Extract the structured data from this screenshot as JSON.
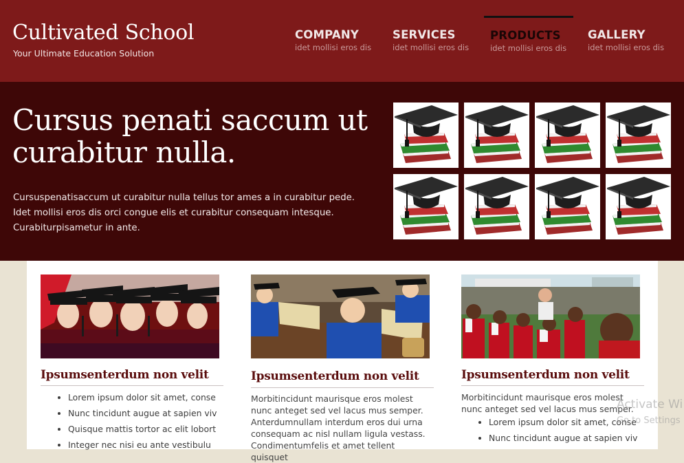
{
  "header": {
    "title": "Cultivated School",
    "subtitle": "Your Ultimate Education Solution",
    "nav": [
      {
        "label": "COMPANY",
        "sub": "idet mollisi eros dis",
        "active": false
      },
      {
        "label": "SERVICES",
        "sub": "idet mollisi eros dis",
        "active": false
      },
      {
        "label": "PRODUCTS",
        "sub": "idet mollisi eros dis",
        "active": true
      },
      {
        "label": "GALLERY",
        "sub": "idet mollisi eros dis",
        "active": false
      }
    ]
  },
  "hero": {
    "title": "Cursus penati saccum ut curabitur nulla.",
    "text": "Cursuspenatisaccum ut curabitur nulla tellus tor ames a in curabitur pede. Idet mollisi eros dis orci congue elis et curabitur consequam intesque. Curabiturpisametur in ante.",
    "thumbnail_icon": "graduation-cap-books-icon"
  },
  "columns": [
    {
      "title": "Ipsumsenterdum non velit",
      "photo": "graduates-photo",
      "items": [
        "Lorem ipsum dolor sit amet, conse",
        "Nunc tincidunt augue at sapien viv",
        "Quisque mattis tortor ac elit lobort",
        "Integer nec nisi eu ante vestibulu"
      ]
    },
    {
      "title": "Ipsumsenterdum non velit",
      "photo": "students-classroom-photo",
      "paragraph": "Morbitincidunt maurisque eros molest nunc anteget sed vel lacus mus semper. Anterdumnullam interdum eros dui urna consequam ac nisl nullam ligula vestass. Condimentumfelis et amet tellent quisquet"
    },
    {
      "title": "Ipsumsenterdum non velit",
      "photo": "children-celebration-photo",
      "paragraph": "Morbitincidunt maurisque eros molest nunc anteget sed vel lacus mus semper.",
      "items": [
        "Lorem ipsum dolor sit amet, conse",
        "Nunc tincidunt augue at sapien viv"
      ]
    }
  ],
  "overlay": {
    "line1": "Activate Wi",
    "line2": "Go to Settings"
  },
  "colors": {
    "header_bg": "#7e1a1a",
    "hero_bg": "#3e0707",
    "page_bg": "#e9e3d3",
    "heading": "#5a0d0d"
  }
}
